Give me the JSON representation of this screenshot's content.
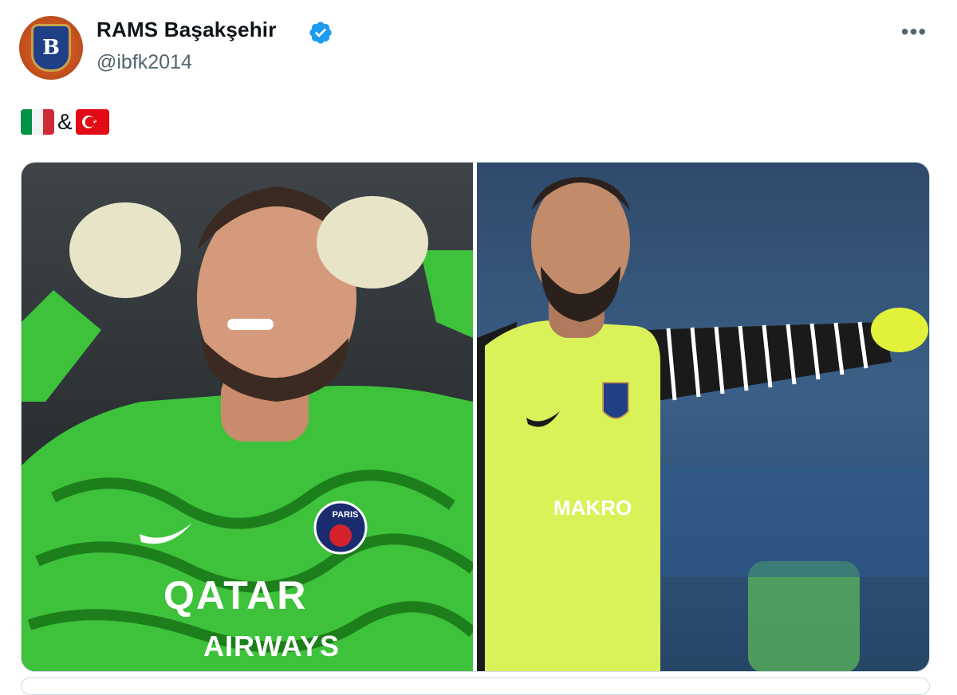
{
  "account": {
    "display_name": "RAMS Başakşehir",
    "handle": "@ibfk2014",
    "avatar_letter": "B",
    "verified_icon": "verified-badge-icon",
    "verified_color": "#1d9bf0"
  },
  "menu": {
    "more_label": "•••",
    "icon": "more-options-icon"
  },
  "tweet": {
    "flags": [
      "italy-flag-icon",
      "turkey-flag-icon"
    ],
    "separator": "&"
  },
  "media": {
    "left": {
      "sponsor_line1": "QATAR",
      "sponsor_line2": "AIRWAYS",
      "crest_text": "PARIS"
    },
    "right": {
      "sponsor": "MAKRO"
    }
  },
  "colors": {
    "text_primary": "#0f1419",
    "text_secondary": "#536471",
    "border": "#cfd9de",
    "psg_green": "#3ec23b",
    "basak_neon": "#d9f25a"
  }
}
